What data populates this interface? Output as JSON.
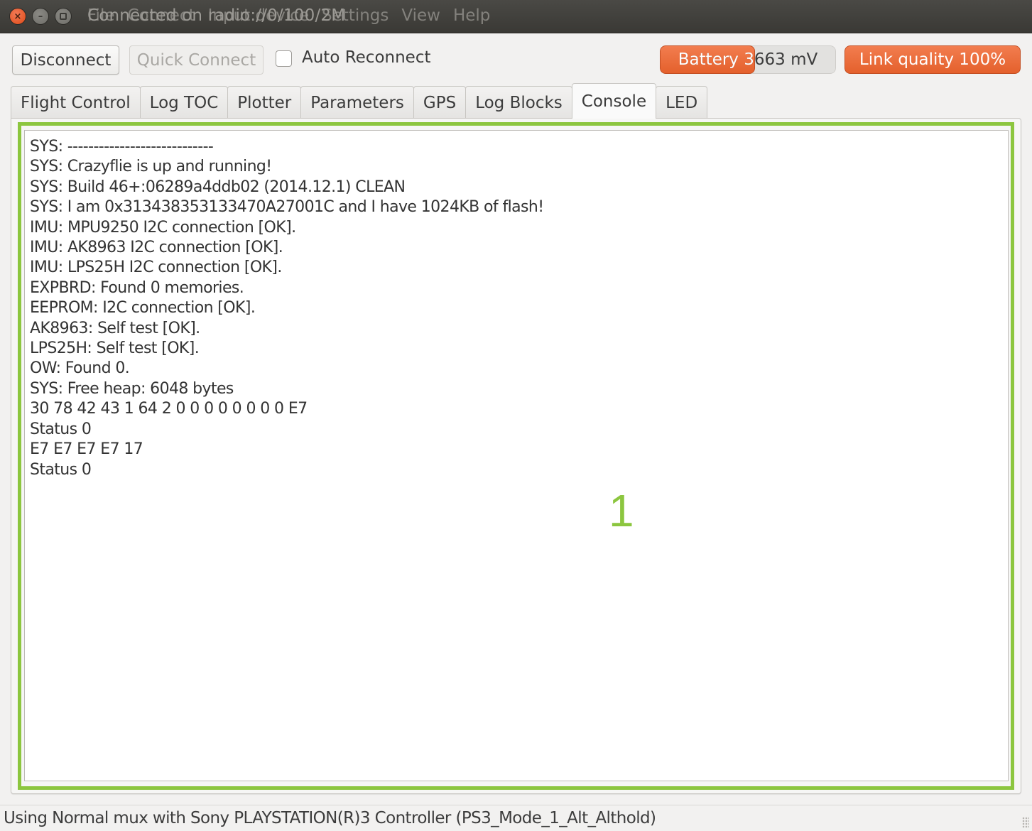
{
  "window": {
    "title": "Connected on radio://0/100/2M",
    "menu": [
      "File",
      "Connect",
      "Input device",
      "Settings",
      "View",
      "Help"
    ],
    "controls": {
      "close": "×",
      "minimize": "–"
    }
  },
  "toolbar": {
    "disconnect_label": "Disconnect",
    "quick_connect_label": "Quick Connect",
    "auto_reconnect_label": "Auto Reconnect",
    "auto_reconnect_checked": false
  },
  "indicators": {
    "battery": {
      "label": "Battery 3663 mV",
      "fill_fraction": 0.54,
      "color": "#e96a3a"
    },
    "link_quality": {
      "label": "Link quality 100%",
      "fill_fraction": 1.0,
      "color": "#e96a3a"
    }
  },
  "tabs": [
    {
      "label": "Flight Control",
      "active": false
    },
    {
      "label": "Log TOC",
      "active": false
    },
    {
      "label": "Plotter",
      "active": false
    },
    {
      "label": "Parameters",
      "active": false
    },
    {
      "label": "GPS",
      "active": false
    },
    {
      "label": "Log Blocks",
      "active": false
    },
    {
      "label": "Console",
      "active": true
    },
    {
      "label": "LED",
      "active": false
    }
  ],
  "console": {
    "lines": [
      "SYS: ----------------------------",
      "SYS: Crazyflie is up and running!",
      "SYS: Build 46+:06289a4ddb02 (2014.12.1) CLEAN",
      "SYS: I am 0x313438353133470A27001C and I have 1024KB of flash!",
      "IMU: MPU9250 I2C connection [OK].",
      "IMU: AK8963 I2C connection [OK].",
      "IMU: LPS25H I2C connection [OK].",
      "EXPBRD: Found 0 memories.",
      "EEPROM: I2C connection [OK].",
      "AK8963: Self test [OK].",
      "LPS25H: Self test [OK].",
      "OW: Found 0.",
      "SYS: Free heap: 6048 bytes",
      "30 78 42 43 1 64 2 0 0 0 0 0 0 0 0 E7",
      "Status 0",
      "E7 E7 E7 E7 17",
      "Status 0"
    ]
  },
  "annotation": {
    "marker_label": "1",
    "color": "#8cc63f"
  },
  "statusbar": {
    "text": "Using Normal mux with Sony PLAYSTATION(R)3 Controller (PS3_Mode_1_Alt_Althold)"
  }
}
